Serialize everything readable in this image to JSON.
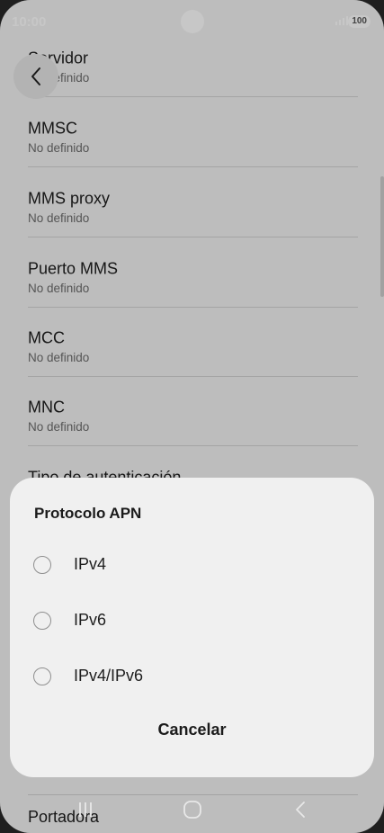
{
  "status_bar": {
    "time": "10:00",
    "battery": "100"
  },
  "settings_list": {
    "items": [
      {
        "title": "Servidor",
        "value": "No definido"
      },
      {
        "title": "MMSC",
        "value": "No definido"
      },
      {
        "title": "MMS proxy",
        "value": "No definido"
      },
      {
        "title": "Puerto MMS",
        "value": "No definido"
      },
      {
        "title": "MCC",
        "value": "No definido"
      },
      {
        "title": "MNC",
        "value": "No definido"
      },
      {
        "title": "Tipo de autenticación",
        "value": ""
      }
    ],
    "bottom_item_title": "Portadora"
  },
  "dialog": {
    "title": "Protocolo APN",
    "options": [
      {
        "label": "IPv4",
        "selected": false
      },
      {
        "label": "IPv6",
        "selected": false
      },
      {
        "label": "IPv4/IPv6",
        "selected": false
      }
    ],
    "cancel_label": "Cancelar"
  },
  "icons": {
    "back": "back-arrow-icon",
    "recent_apps": "recent-apps-icon",
    "home": "home-icon",
    "nav_back": "nav-back-icon"
  },
  "colors": {
    "sheet_background": "#f0f0f0",
    "scrim": "rgba(0,0,0,0.22)"
  }
}
